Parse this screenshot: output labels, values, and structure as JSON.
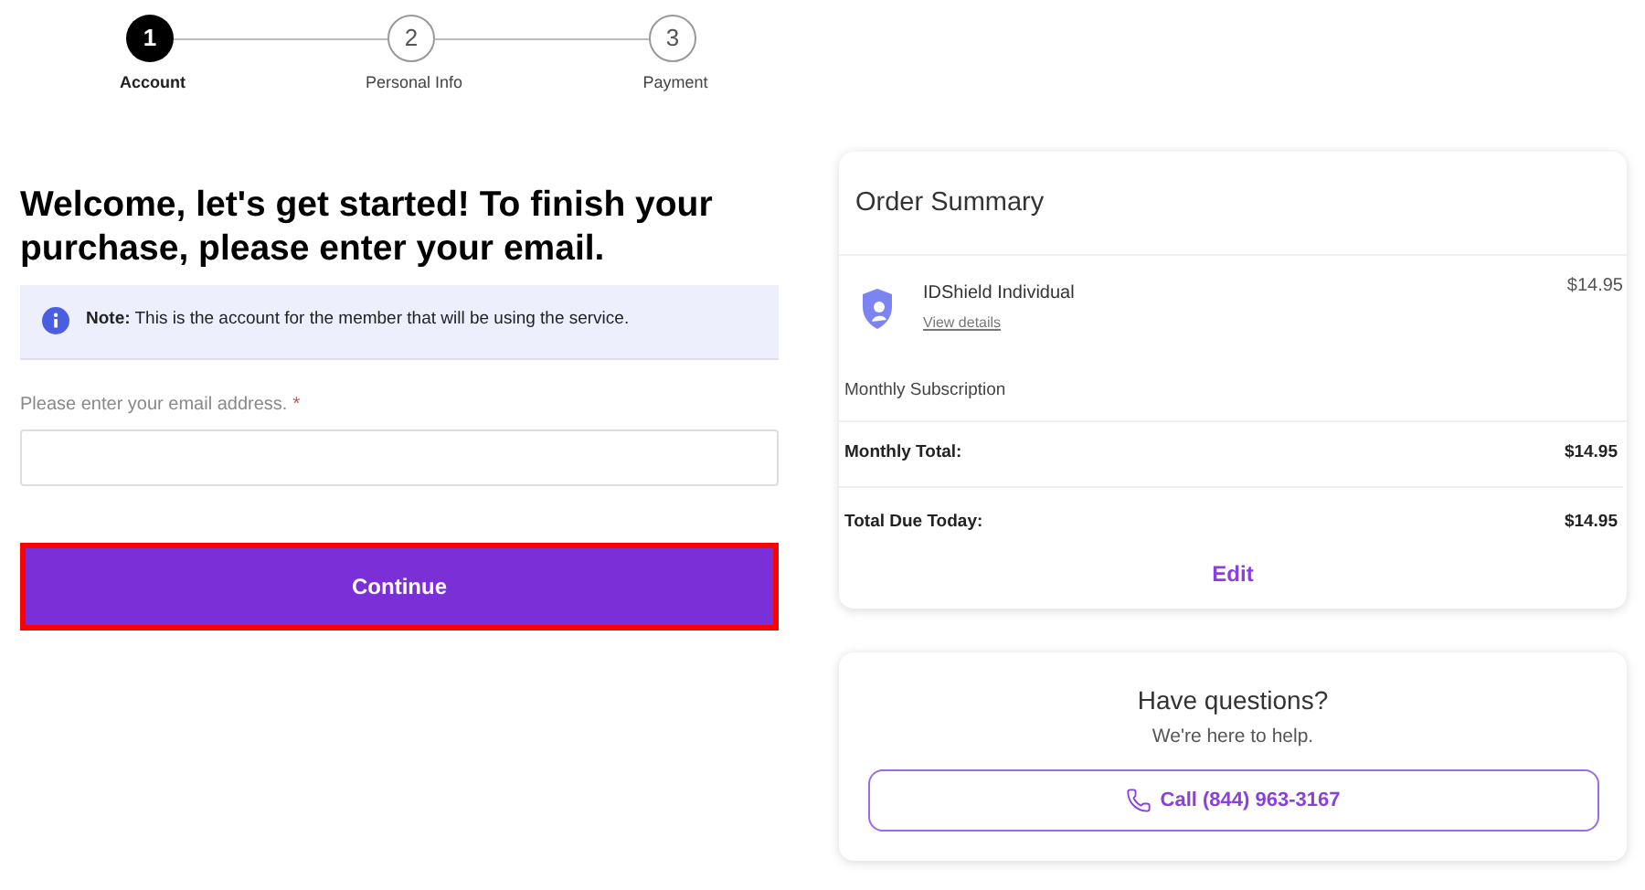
{
  "stepper": [
    {
      "number": "1",
      "label": "Account",
      "selected": true
    },
    {
      "number": "2",
      "label": "Personal Info",
      "selected": false
    },
    {
      "number": "3",
      "label": "Payment",
      "selected": false
    }
  ],
  "heading": "Welcome, let's get started! To finish your purchase, please enter your email.",
  "note": "**Note:** This is the account for the member that will be using the service.",
  "email_field": {
    "label": "Please enter your email address.",
    "required_mark": "*"
  },
  "continue_button": {
    "label": "Continue",
    "highlighted": true
  },
  "order_summary": {
    "title": "Order Summary",
    "product": {
      "name": "IDShield Individual",
      "link": "View details",
      "price": "$14.95"
    },
    "subscription": "Monthly Subscription",
    "monthly_total": {
      "label": "Monthly Total:",
      "value": "$14.95"
    },
    "total_due": {
      "label": "Total Due Today:",
      "value": "$14.95"
    },
    "edit": "Edit"
  },
  "help": {
    "title": "Have questions?",
    "subtitle": "We're here to help.",
    "call_button": "Call (844) 963-3167"
  }
}
